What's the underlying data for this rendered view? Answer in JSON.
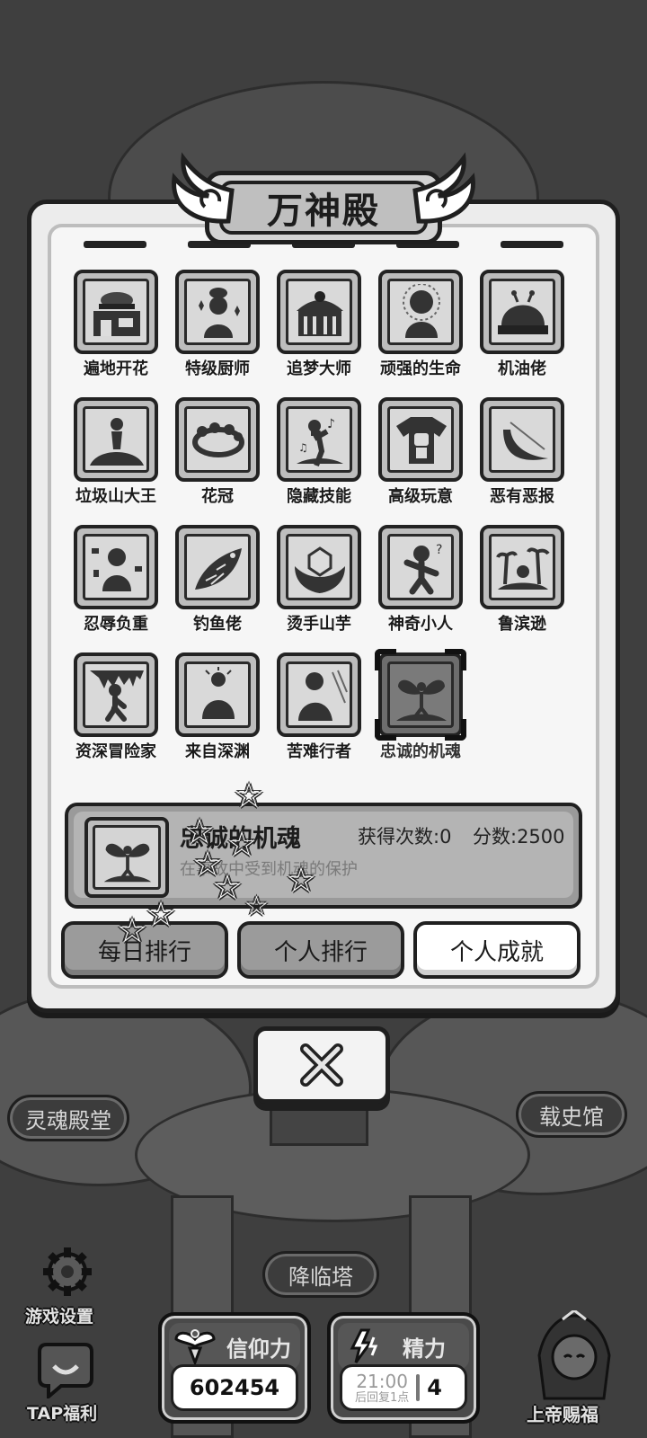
{
  "modal": {
    "title": "万神殿",
    "achievements": [
      {
        "name": "遍地开花",
        "icon": "burger-shop-icon"
      },
      {
        "name": "特级厨师",
        "icon": "chef-icon"
      },
      {
        "name": "追梦大师",
        "icon": "dream-building-icon"
      },
      {
        "name": "顽强的生命",
        "icon": "glowing-figure-icon"
      },
      {
        "name": "机油佬",
        "icon": "dome-robot-icon"
      },
      {
        "name": "垃圾山大王",
        "icon": "trash-king-icon"
      },
      {
        "name": "花冠",
        "icon": "flower-crown-icon"
      },
      {
        "name": "隐藏技能",
        "icon": "singing-figure-icon"
      },
      {
        "name": "高级玩意",
        "icon": "robot-shirt-icon"
      },
      {
        "name": "恶有恶报",
        "icon": "boomerang-icon"
      },
      {
        "name": "忍辱负重",
        "icon": "kneeling-figure-icon"
      },
      {
        "name": "钓鱼佬",
        "icon": "fish-icon"
      },
      {
        "name": "烫手山芋",
        "icon": "hands-gem-icon"
      },
      {
        "name": "神奇小人",
        "icon": "confused-figure-icon"
      },
      {
        "name": "鲁滨逊",
        "icon": "island-icon"
      },
      {
        "name": "资深冒险家",
        "icon": "cave-figure-icon"
      },
      {
        "name": "来自深渊",
        "icon": "abyss-figure-icon"
      },
      {
        "name": "苦难行者",
        "icon": "walking-figure-icon"
      },
      {
        "name": "忠诚的机魂",
        "icon": "fairy-icon",
        "selected": true
      }
    ],
    "detail": {
      "name": "忠诚的机魂",
      "count": "获得次数:0",
      "score": "分数:2500",
      "description": "在事故中受到机魂的保护"
    },
    "tabs": {
      "daily": "每日排行",
      "personal": "个人排行",
      "achievements": "个人成就"
    }
  },
  "scene": {
    "soul_hall": "灵魂殿堂",
    "history_hall": "载史馆",
    "descend_tower": "降临塔",
    "settings": "游戏设置",
    "tap_bonus": "TAP福利",
    "god_blessing": "上帝赐福"
  },
  "stats": {
    "faith_label": "信仰力",
    "faith_value": "602454",
    "energy_label": "精力",
    "energy_timer": "21:00",
    "energy_hint": "后回复1点",
    "energy_value": "4"
  }
}
